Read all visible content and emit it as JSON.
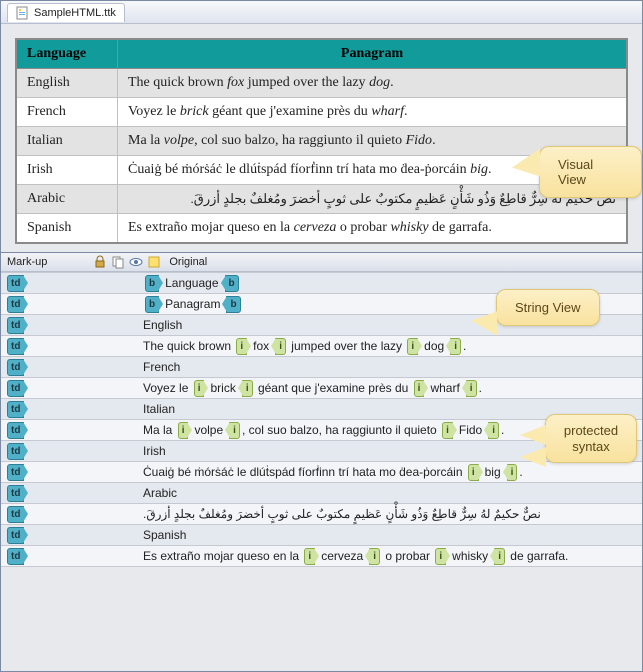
{
  "window": {
    "title": "SampleHTML.ttk"
  },
  "table": {
    "headers": {
      "lang": "Language",
      "panagram": "Panagram"
    },
    "rows": [
      {
        "lang": "English",
        "pre1": "The quick brown ",
        "i1": "fox",
        "mid": " jumped over the lazy ",
        "i2": "dog",
        "post": "."
      },
      {
        "lang": "French",
        "pre1": "Voyez le ",
        "i1": "brick",
        "mid": " géant que j'examine près du ",
        "i2": "wharf",
        "post": "."
      },
      {
        "lang": "Italian",
        "pre1": "Ma la ",
        "i1": "volpe",
        "mid": ", col suo balzo, ha raggiunto il quieto ",
        "i2": "Fido",
        "post": "."
      },
      {
        "lang": "Irish",
        "pre1": "Ċuaiġ bé ṁórṡáċ le dlúṫspád fíorḟinn trí hata mo ḋea-ṗorcáin ",
        "i1": "big",
        "mid": "",
        "i2": "",
        "post": "."
      },
      {
        "lang": "Arabic",
        "arabic": "نصٌّ حكيمٌ لهُ سِرٌّ قاطِعٌ وَذُو شَأْنٍ عَظيمٍ مكتوبٌ على ثوبٍ أخضرَ ومُغلفٌ بجلدٍ أزرقَ."
      },
      {
        "lang": "Spanish",
        "pre1": "Es extraño mojar queso en la ",
        "i1": "cerveza",
        "mid": " o probar ",
        "i2": "whisky",
        "post": " de garrafa."
      }
    ]
  },
  "markup_bar": {
    "label": "Mark-up",
    "col2": "Original"
  },
  "tagnames": {
    "td": "td",
    "b": "b",
    "i": "i"
  },
  "grid": {
    "rows": [
      {
        "kind": "b",
        "text": "Language"
      },
      {
        "kind": "b",
        "text": "Panagram"
      },
      {
        "kind": "plain",
        "text": "English"
      },
      {
        "kind": "i2",
        "p": [
          "The quick brown ",
          "fox",
          " jumped over the lazy ",
          "dog",
          "."
        ]
      },
      {
        "kind": "plain",
        "text": "French"
      },
      {
        "kind": "i2",
        "p": [
          "Voyez le ",
          "brick",
          " géant que j'examine près du ",
          "wharf",
          "."
        ]
      },
      {
        "kind": "plain",
        "text": "Italian"
      },
      {
        "kind": "i2",
        "p": [
          "Ma la ",
          "volpe",
          ", col suo balzo, ha raggiunto il quieto ",
          "Fido",
          "."
        ]
      },
      {
        "kind": "plain",
        "text": "Irish"
      },
      {
        "kind": "i1",
        "p": [
          "Ċuaiġ bé ṁórṡáċ le dlúṫspád fíorḟinn trí hata mo ḋea-ṗorcáin ",
          "big",
          "."
        ]
      },
      {
        "kind": "plain",
        "text": "Arabic"
      },
      {
        "kind": "rtl",
        "text": "نصٌّ حكيمٌ لهُ سِرٌّ قاطِعٌ وَذُو شَأْنٍ عَظيمٍ مكتوبٌ على ثوبٍ أخضرَ ومُغلفٌ بجلدٍ أزرقَ."
      },
      {
        "kind": "plain",
        "text": "Spanish"
      },
      {
        "kind": "i2",
        "p": [
          "Es extraño mojar queso en la ",
          "cerveza",
          " o probar ",
          "whisky",
          " de garrafa."
        ]
      }
    ]
  },
  "callouts": {
    "visual": "Visual View",
    "string": "String View",
    "protected": "protected syntax"
  }
}
